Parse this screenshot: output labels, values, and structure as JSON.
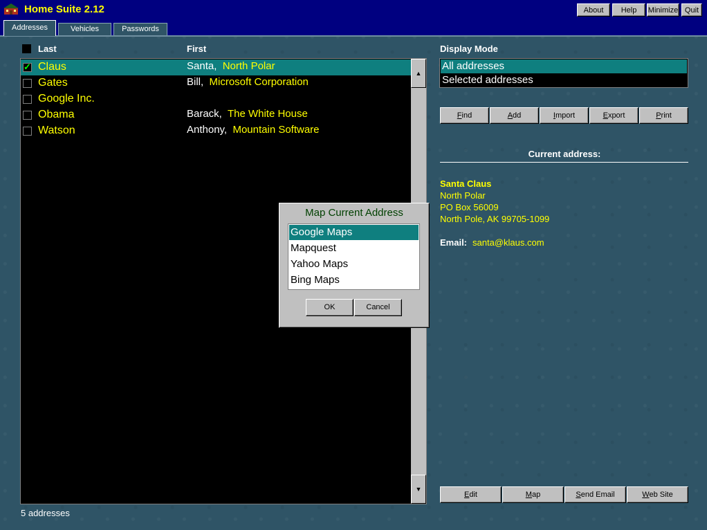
{
  "app": {
    "title": "Home Suite 2.12"
  },
  "window_buttons": {
    "about": "About",
    "help": "Help",
    "minimize": "Minimize",
    "quit": "Quit"
  },
  "tabs": [
    "Addresses",
    "Vehicles",
    "Passwords"
  ],
  "list": {
    "headers": {
      "last": "Last",
      "first": "First"
    },
    "rows": [
      {
        "last": "Claus",
        "first": "Santa,",
        "company": "North Polar",
        "checked": true,
        "selected": true
      },
      {
        "last": "Gates",
        "first": "Bill,",
        "company": "Microsoft Corporation",
        "checked": false,
        "selected": false
      },
      {
        "last": "Google Inc.",
        "first": "",
        "company": "",
        "checked": false,
        "selected": false
      },
      {
        "last": "Obama",
        "first": "Barack,",
        "company": "The White House",
        "checked": false,
        "selected": false
      },
      {
        "last": "Watson",
        "first": "Anthony,",
        "company": "Mountain Software",
        "checked": false,
        "selected": false
      }
    ]
  },
  "status": "5 addresses",
  "display_mode": {
    "title": "Display Mode",
    "options": [
      "All addresses",
      "Selected addresses"
    ],
    "selected": "All addresses"
  },
  "top_buttons": [
    "Find",
    "Add",
    "Import",
    "Export",
    "Print"
  ],
  "current_address": {
    "title": "Current address:",
    "name": "Santa Claus",
    "line1": "North Polar",
    "line2": "PO Box 56009",
    "line3": "North Pole, AK  99705-1099",
    "email_label": "Email:",
    "email": "santa@klaus.com"
  },
  "bottom_buttons": [
    "Edit",
    "Map",
    "Send Email",
    "Web Site"
  ],
  "map_dialog": {
    "title": "Map Current Address",
    "options": [
      "Google Maps",
      "Mapquest",
      "Yahoo Maps",
      "Bing Maps"
    ],
    "selected": "Google Maps",
    "ok": "OK",
    "cancel": "Cancel"
  },
  "colors": {
    "titlebar": "#000080",
    "selection": "#0f7f7f",
    "highlight_text": "#ffff00",
    "background": "#2f5466"
  }
}
